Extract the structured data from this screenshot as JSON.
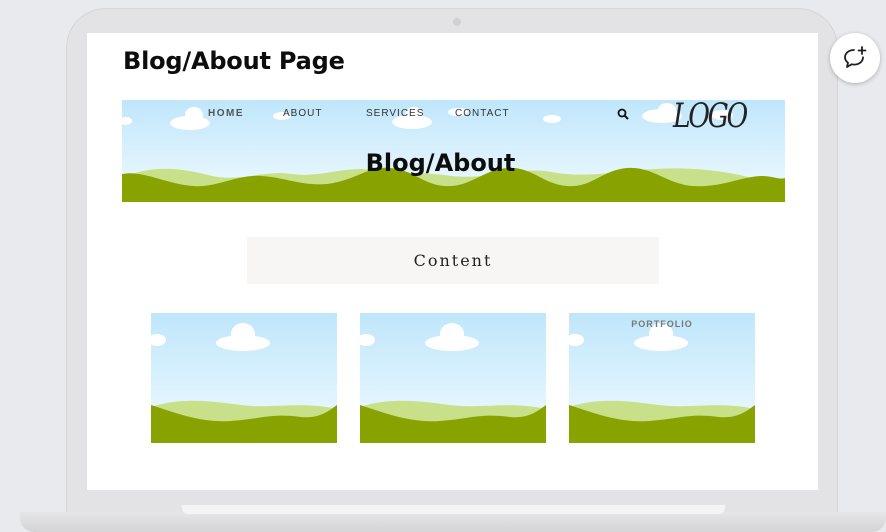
{
  "page": {
    "title": "Blog/About Page"
  },
  "banner": {
    "nav": [
      {
        "label": "HOME",
        "active": true
      },
      {
        "label": "ABOUT",
        "active": false
      },
      {
        "label": "SERVICES",
        "active": false
      },
      {
        "label": "CONTACT",
        "active": false
      }
    ],
    "logo_text": "LOGO",
    "heading": "Blog/About",
    "icons": {
      "search": "search-icon"
    }
  },
  "content": {
    "label": "Content"
  },
  "cards": [
    {
      "label": ""
    },
    {
      "label": ""
    },
    {
      "label": "PORTFOLIO"
    }
  ],
  "floating": {
    "icon": "comment-plus-icon"
  },
  "colors": {
    "sky_top": "#bfe6fb",
    "sky_bottom": "#f2fbff",
    "hill_dark": "#88a300",
    "hill_light": "#c8e08a",
    "content_box": "#f7f6f4"
  }
}
